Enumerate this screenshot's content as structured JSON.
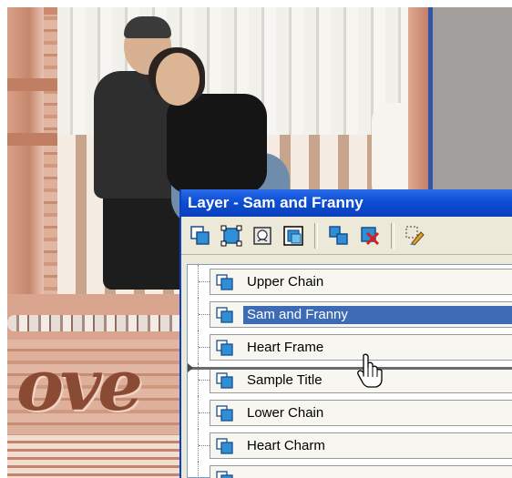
{
  "artwork": {
    "script_text": "ove"
  },
  "palette": {
    "title": "Layer - Sam and Franny",
    "toolbar": [
      {
        "icon": "new-raster-layer-icon"
      },
      {
        "icon": "new-vector-layer-icon"
      },
      {
        "icon": "new-mask-layer-icon"
      },
      {
        "icon": "new-adjustment-layer-icon"
      },
      {
        "icon": "duplicate-layer-icon"
      },
      {
        "icon": "delete-layer-icon"
      },
      {
        "icon": "edit-selected-layer-icon"
      }
    ],
    "layers": [
      {
        "label": "Upper Chain",
        "selected": false
      },
      {
        "label": "Sam and Franny",
        "selected": true
      },
      {
        "label": "Heart Frame",
        "selected": false
      },
      {
        "label": "Sample Title",
        "selected": false
      },
      {
        "label": "Lower Chain",
        "selected": false
      },
      {
        "label": "Heart Charm",
        "selected": false
      }
    ]
  },
  "colors": {
    "title_bar": "#0c4ed6",
    "selection": "#3d6bb5",
    "layer_icon": "#2f8fd6"
  }
}
